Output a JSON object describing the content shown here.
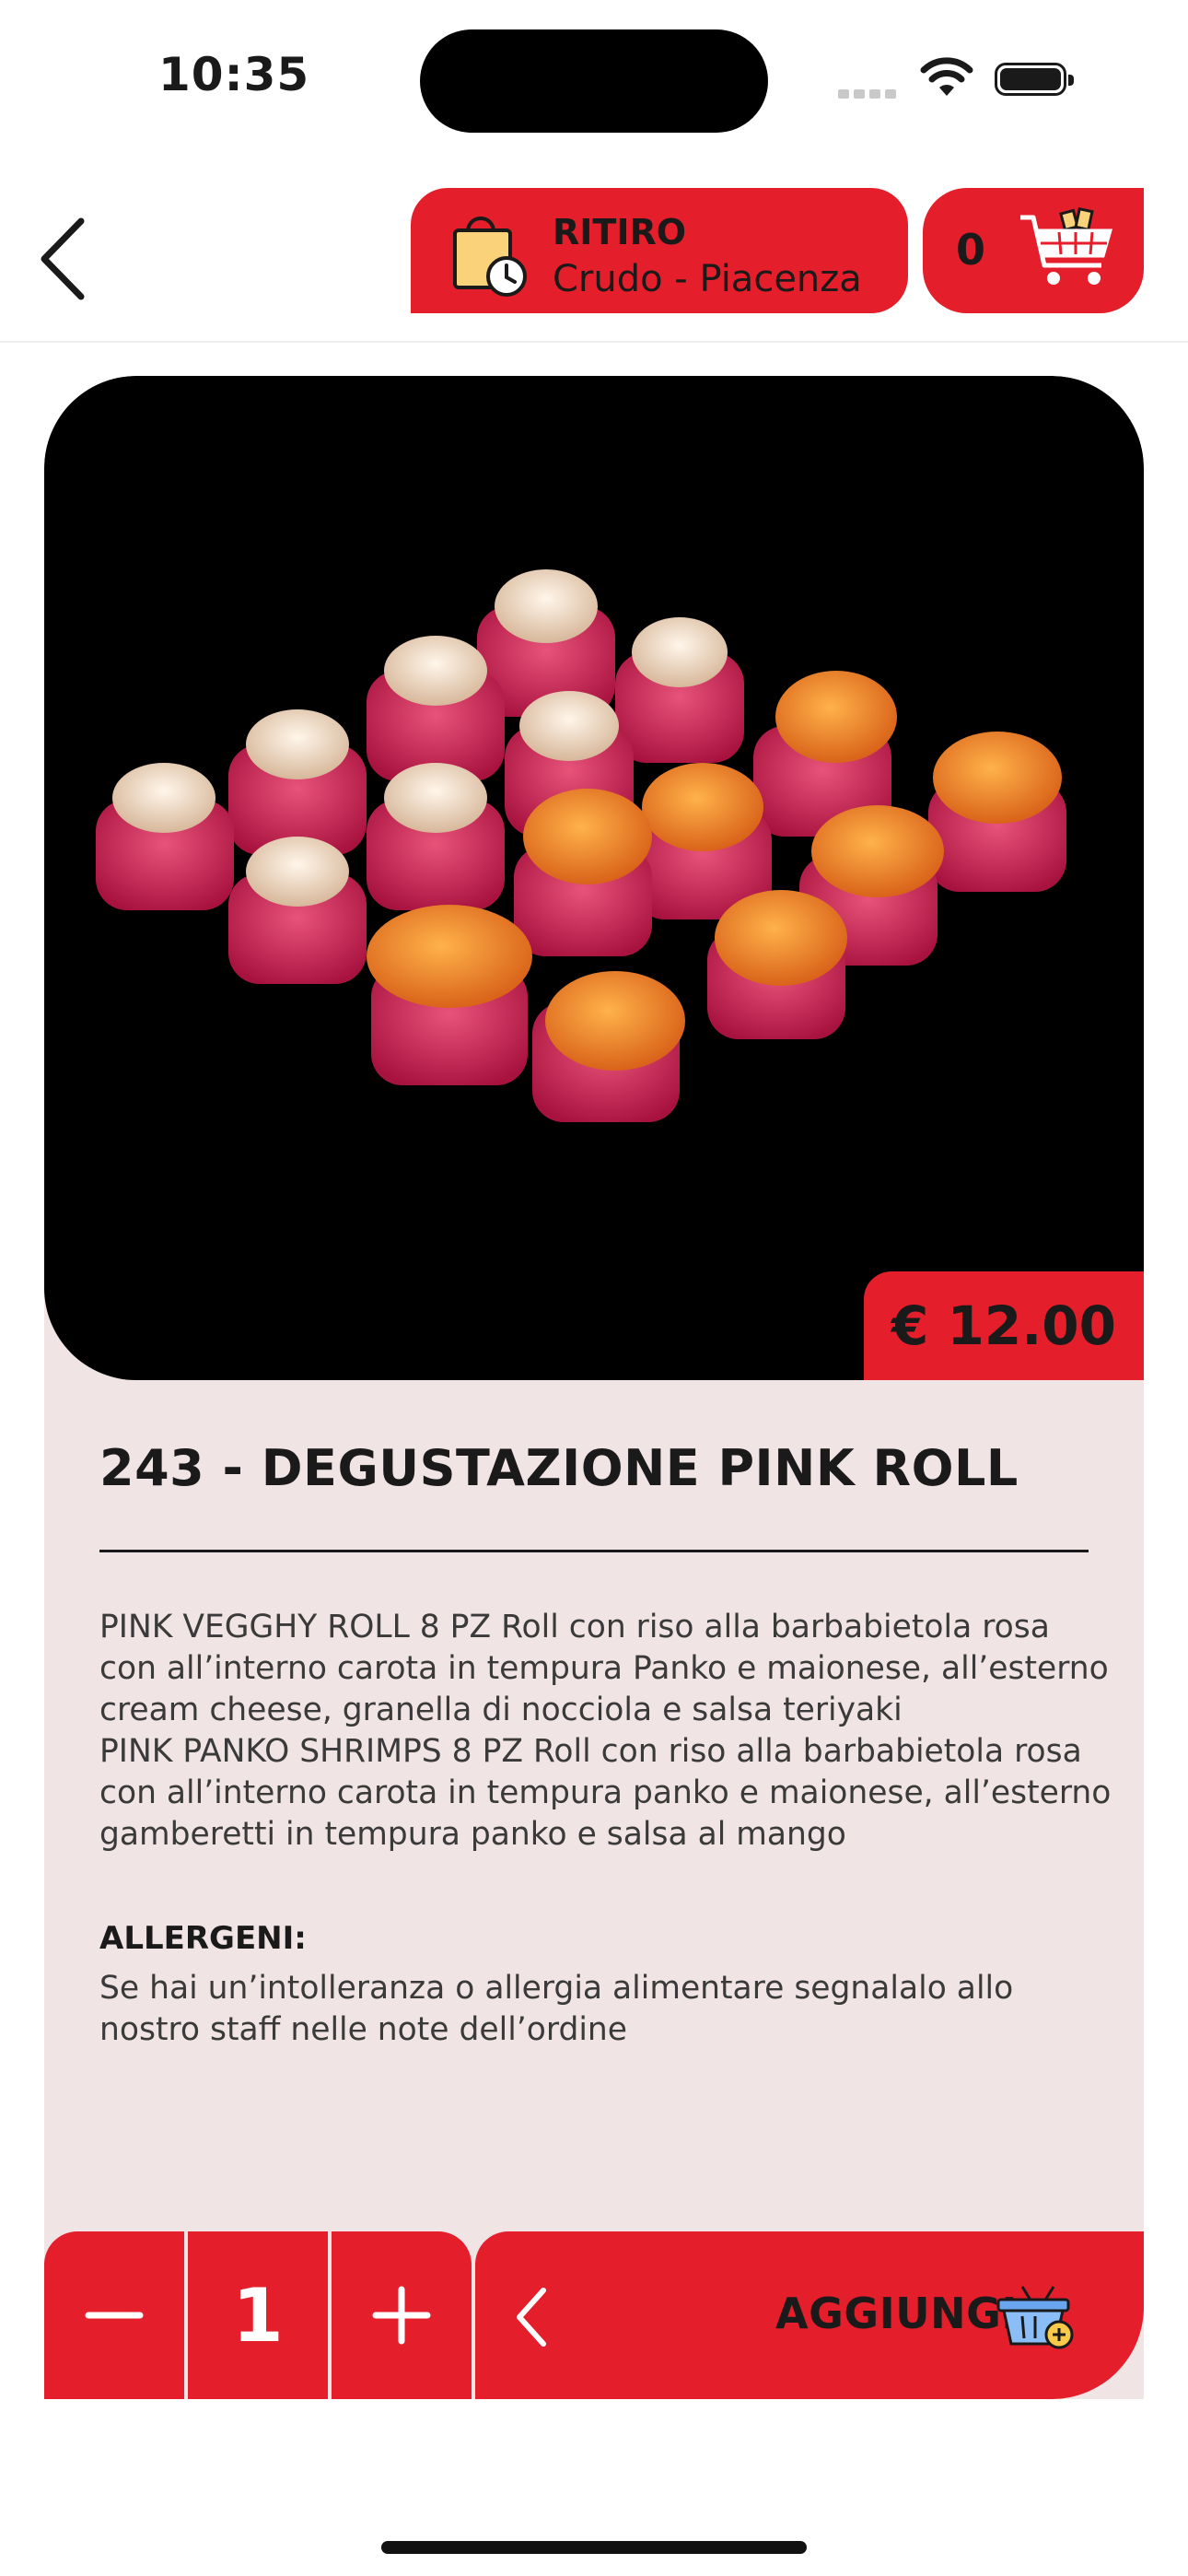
{
  "status_bar": {
    "time": "10:35"
  },
  "header": {
    "pickup_mode": "RITIRO",
    "store_name": "Crudo - Piacenza",
    "cart_count": "0"
  },
  "product": {
    "price": "€ 12.00",
    "title": "243 - DEGUSTAZIONE PINK ROLL",
    "description": "PINK VEGGHY ROLL 8 PZ Roll con riso alla barbabietola rosa con all’interno carota in tempura Panko e maionese, all’esterno cream cheese, granella di nocciola e salsa teriyaki\nPINK PANKO SHRIMPS 8 PZ Roll con riso alla barbabietola rosa con all’interno carota in tempura panko e maionese, all’esterno gamberetti in tempura panko e salsa al mango",
    "allergen_title": "ALLERGENI:",
    "allergen_text": "Se hai un’intolleranza o allergia alimentare segnalalo allo nostro staff nelle note dell’ordine"
  },
  "action_bar": {
    "quantity": "1",
    "add_label": "AGGIUNGI"
  },
  "colors": {
    "accent": "#e41e2a",
    "card_bg": "#f0e4e5",
    "photo_bg": "#000000"
  },
  "icons": [
    "back-chevron-icon",
    "shopping-bag-clock-icon",
    "cart-icon",
    "minus-icon",
    "plus-icon",
    "chevron-left-icon",
    "basket-add-icon"
  ]
}
